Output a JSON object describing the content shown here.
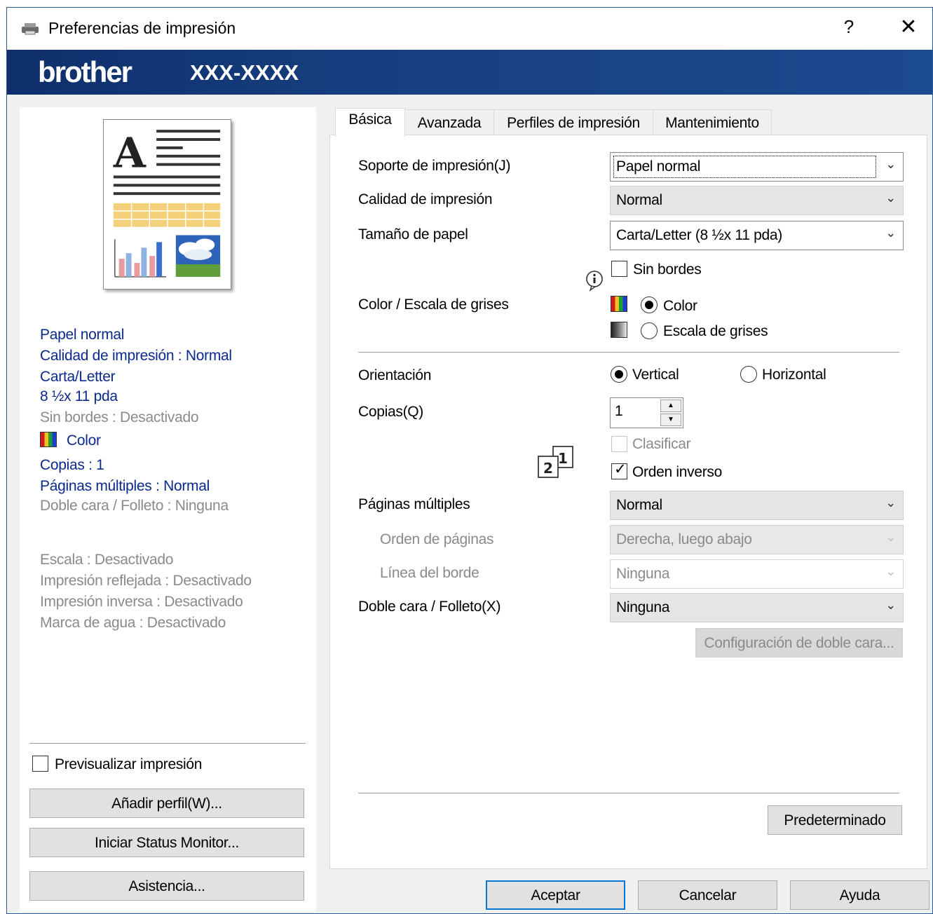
{
  "window": {
    "title": "Preferencias de impresión",
    "help_glyph": "?",
    "close_glyph": "✕"
  },
  "banner": {
    "brand": "brother",
    "model": "XXX-XXXX"
  },
  "summary": {
    "lines": [
      "Papel normal",
      "Calidad de impresión : Normal",
      "Carta/Letter",
      "8 ½x 11 pda",
      "Sin bordes : Desactivado",
      "Color",
      "Copias : 1",
      "Páginas múltiples : Normal",
      "Doble cara / Folleto : Ninguna",
      "Escala : Desactivado",
      "Impresión reflejada : Desactivado",
      "Impresión inversa : Desactivado",
      "Marca de agua : Desactivado"
    ]
  },
  "left_actions": {
    "preview_label": "Previsualizar impresión",
    "preview_checked": false,
    "add_profile": "Añadir perfil(W)...",
    "status_monitor": "Iniciar Status Monitor...",
    "support": "Asistencia..."
  },
  "tabs": [
    "Básica",
    "Avanzada",
    "Perfiles de impresión",
    "Mantenimiento"
  ],
  "active_tab": "Básica",
  "form": {
    "media_label": "Soporte de impresión(J)",
    "media_value": "Papel normal",
    "quality_label": "Calidad de impresión",
    "quality_value": "Normal",
    "paper_label": "Tamaño de papel",
    "paper_value": "Carta/Letter (8 ½x 11 pda)",
    "borderless_label": "Sin bordes",
    "borderless_checked": false,
    "color_label": "Color / Escala de grises",
    "color_option": "Color",
    "grey_option": "Escala de grises",
    "color_selected": "Color",
    "orientation_label": "Orientación",
    "portrait": "Vertical",
    "landscape": "Horizontal",
    "orientation_selected": "Vertical",
    "copies_label": "Copias(Q)",
    "copies_value": "1",
    "collate_label": "Clasificar",
    "collate_checked": false,
    "reverse_label": "Orden inverso",
    "reverse_checked": true,
    "multi_label": "Páginas múltiples",
    "multi_value": "Normal",
    "page_order_label": "Orden de páginas",
    "page_order_value": "Derecha, luego abajo",
    "border_label": "Línea del borde",
    "border_value": "Ninguna",
    "duplex_label": "Doble cara / Folleto(X)",
    "duplex_value": "Ninguna",
    "duplex_settings": "Configuración de doble cara...",
    "default_button": "Predeterminado",
    "pages_icon_numbers": [
      "1",
      "2"
    ]
  },
  "footer": {
    "ok": "Aceptar",
    "cancel": "Cancelar",
    "help": "Ayuda"
  },
  "icons": {
    "printer": "printer-icon",
    "info": "info-icon",
    "color_swatch": "color-swatch-icon",
    "grey_swatch": "grayscale-swatch-icon",
    "pages": "multiple-pages-icon",
    "chevron": "chevron-down-icon"
  },
  "colors": {
    "banner": "#173f80",
    "accent": "#0078d7",
    "summary_text": "#0b2a8c"
  }
}
